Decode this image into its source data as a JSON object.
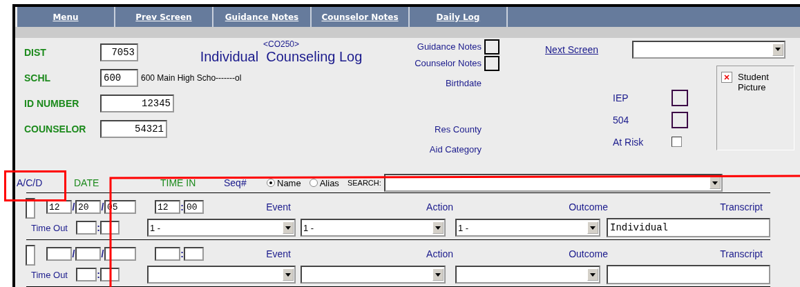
{
  "nav": [
    {
      "label": "Menu"
    },
    {
      "label": "Prev Screen"
    },
    {
      "label": "Guidance Notes"
    },
    {
      "label": "Counselor Notes"
    },
    {
      "label": "Daily Log"
    }
  ],
  "screen_code": "<CO250>",
  "title": "Individual  Counseling Log",
  "fields": [
    {
      "label": "DIST",
      "value": "7053"
    },
    {
      "label": "SCHL",
      "value": "600",
      "description": "600 Main High Scho-------ol"
    },
    {
      "label": "ID NUMBER",
      "value": "12345"
    },
    {
      "label": "COUNSELOR",
      "value": "54321"
    }
  ],
  "notes": [
    {
      "label": "Guidance Notes",
      "checked": false
    },
    {
      "label": "Counselor Notes",
      "checked": false
    }
  ],
  "info_labels": [
    "Birthdate",
    "Res County",
    "Aid Category"
  ],
  "next_screen": {
    "label": "Next Screen"
  },
  "flags": [
    {
      "label": "IEP",
      "kind": "box",
      "checked": false
    },
    {
      "label": "504",
      "kind": "box",
      "checked": false
    },
    {
      "label": "At Risk",
      "kind": "checkbox",
      "checked": false
    }
  ],
  "student_picture": {
    "label": "Student Picture"
  },
  "log_columns": [
    "A/C/D",
    "DATE",
    "TIME IN",
    "Seq#"
  ],
  "search_by": [
    {
      "label": "Name",
      "selected": true
    },
    {
      "label": "Alias",
      "selected": false
    }
  ],
  "search_label": "SEARCH:",
  "entries": [
    {
      "date": [
        "12",
        "20",
        "05"
      ],
      "date_separators": [
        "/",
        "/"
      ],
      "time_in": [
        "12",
        "00"
      ],
      "time_in_separator": ":",
      "time_out_label": "Time Out",
      "time_out_separator": ":",
      "event_label": "Event",
      "action_label": "Action",
      "outcome_label": "Outcome",
      "transcript_label": "Transcript",
      "event": "1 -",
      "action": "1 -",
      "outcome": "1 -",
      "transcript": "Individual"
    },
    {
      "date_separators": [
        "/",
        "/"
      ],
      "time_in_separator": ":",
      "time_out_label": "Time Out",
      "time_out_separator": ":",
      "event_label": "Event",
      "action_label": "Action",
      "outcome_label": "Outcome",
      "transcript_label": "Transcript"
    }
  ]
}
